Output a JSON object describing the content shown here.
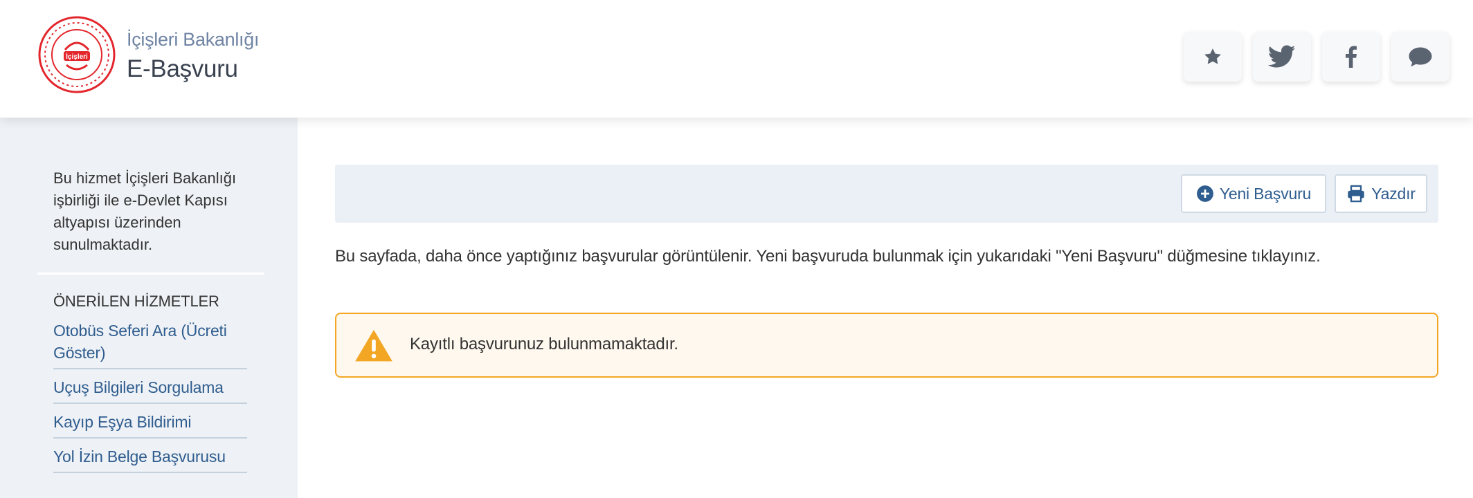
{
  "header": {
    "ministry": "İçişleri Bakanlığı",
    "title": "E-Başvuru",
    "logo_text": "İçişleri",
    "social": [
      {
        "icon": "star-icon"
      },
      {
        "icon": "twitter-icon"
      },
      {
        "icon": "facebook-icon"
      },
      {
        "icon": "comment-icon"
      }
    ]
  },
  "sidebar": {
    "notice": "Bu hizmet İçişleri Bakanlığı işbirliği ile e-Devlet Kapısı altyapısı üzerinden sunulmaktadır.",
    "recommended_title": "ÖNERİLEN HİZMETLER",
    "items": [
      {
        "label": "Otobüs Seferi Ara (Ücreti Göster)"
      },
      {
        "label": "Uçuş Bilgileri Sorgulama"
      },
      {
        "label": "Kayıp Eşya Bildirimi"
      },
      {
        "label": "Yol İzin Belge Başvurusu"
      }
    ]
  },
  "toolbar": {
    "new_application_label": "Yeni Başvuru",
    "print_label": "Yazdır"
  },
  "main": {
    "description": "Bu sayfada, daha önce yaptığınız başvurular görüntülenir. Yeni başvuruda bulunmak için yukarıdaki \"Yeni Başvuru\" düğmesine tıklayınız.",
    "alert_text": "Kayıtlı başvurunuz bulunmamaktadır."
  },
  "colors": {
    "accent": "#2f5d8f",
    "logo_red": "#e3262c",
    "warning": "#f3a623"
  }
}
